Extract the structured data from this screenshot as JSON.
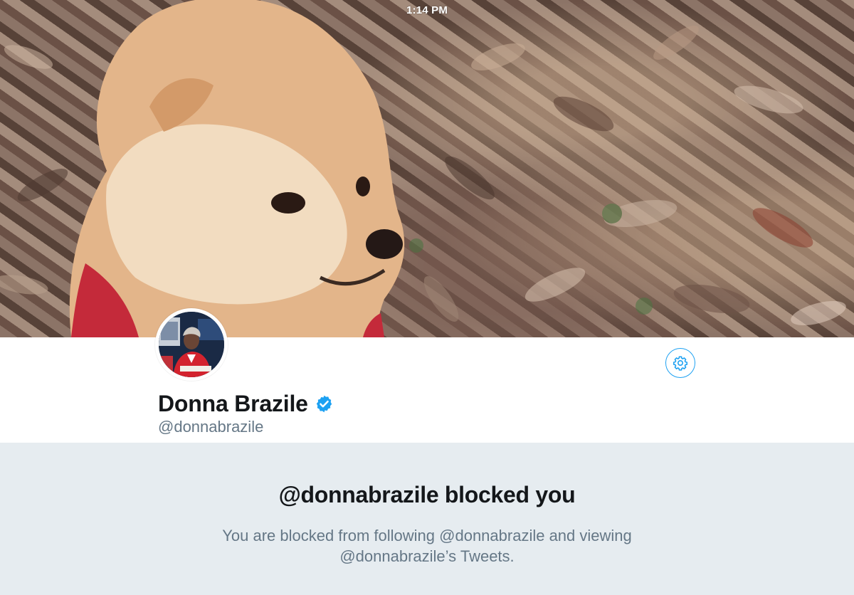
{
  "status_bar": {
    "time": "1:14 PM"
  },
  "profile": {
    "display_name": "Donna Brazile",
    "handle": "@donnabrazile",
    "verified": true
  },
  "blocked": {
    "title": "@donnabrazile blocked you",
    "line1": "You are blocked from following @donnabrazile and viewing",
    "line2": "@donnabrazile’s Tweets."
  },
  "colors": {
    "accent": "#1da1f2",
    "text_primary": "#14171a",
    "text_secondary": "#657786",
    "background": "#e6ecf0"
  },
  "icons": {
    "settings": "gear-icon",
    "verified": "verified-badge-icon"
  }
}
